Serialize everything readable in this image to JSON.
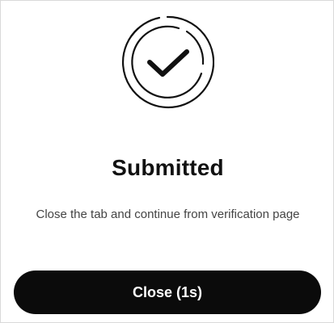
{
  "status_icon": "check-circle-icon",
  "title": "Submitted",
  "message": "Close the tab and continue from verification page",
  "close_button": {
    "label": "Close (1s)"
  },
  "colors": {
    "button_background": "#0b0b0b",
    "button_text": "#ffffff",
    "title_text": "#111111",
    "message_text": "#444444"
  }
}
